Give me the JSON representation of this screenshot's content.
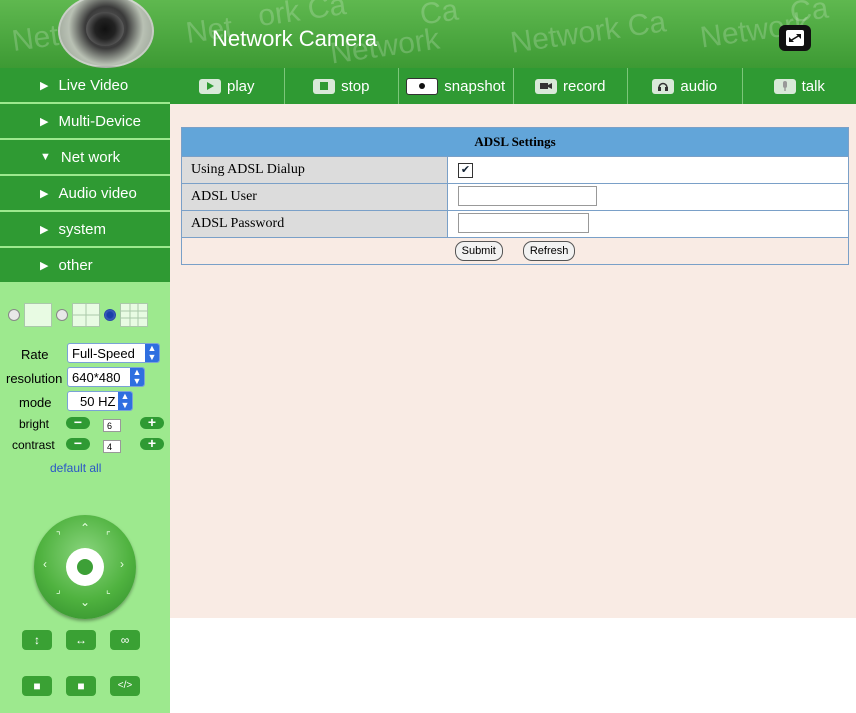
{
  "header": {
    "title": "Network Camera",
    "watermark": "Network Camera"
  },
  "toolbar": {
    "items": [
      {
        "label": "play",
        "icon": "play-icon"
      },
      {
        "label": "stop",
        "icon": "stop-icon"
      },
      {
        "label": "snapshot",
        "icon": "snapshot-icon"
      },
      {
        "label": "record",
        "icon": "record-icon"
      },
      {
        "label": "audio",
        "icon": "audio-icon"
      },
      {
        "label": "talk",
        "icon": "talk-icon"
      }
    ]
  },
  "sidebar": {
    "nav": [
      {
        "label": "Live Video",
        "expanded": false
      },
      {
        "label": "Multi-Device",
        "expanded": false
      },
      {
        "label": "Net work",
        "expanded": true
      },
      {
        "label": "Audio video",
        "expanded": false
      },
      {
        "label": "system",
        "expanded": false
      },
      {
        "label": "other",
        "expanded": false
      }
    ],
    "controls": {
      "rate_label": "Rate",
      "rate_value": "Full-Speed",
      "resolution_label": "resolution",
      "resolution_value": "640*480",
      "mode_label": "mode",
      "mode_value": "50 HZ",
      "bright_label": "bright",
      "bright_value": "6",
      "contrast_label": "contrast",
      "contrast_value": "4",
      "default_all": "default all"
    }
  },
  "adsl": {
    "title": "ADSL Settings",
    "using_dialup_label": "Using ADSL Dialup",
    "using_dialup_checked": true,
    "user_label": "ADSL User",
    "user_value": "",
    "password_label": "ADSL Password",
    "password_value": "",
    "submit_label": "Submit",
    "refresh_label": "Refresh"
  },
  "colors": {
    "nav_green": "#2f9a33",
    "sidebar_bg": "#9de98e",
    "panel_title_bg": "#62a5d9",
    "content_bg": "#f9ebe4"
  }
}
